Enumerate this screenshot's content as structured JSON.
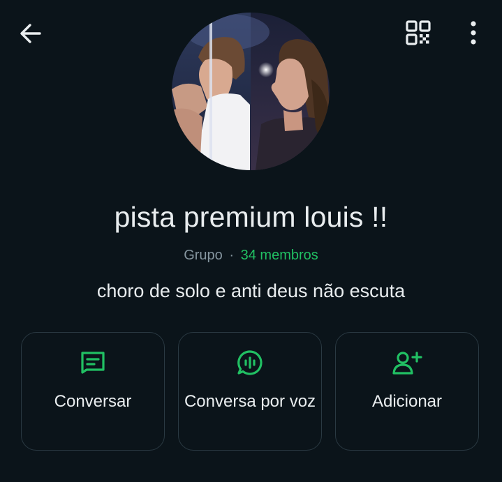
{
  "header": {
    "back_icon": "arrow-left-icon",
    "qr_icon": "qr-code-icon",
    "menu_icon": "more-vertical-icon"
  },
  "group": {
    "name": "pista premium louis !!",
    "type_label": "Grupo",
    "separator": "·",
    "members_label": "34 membros",
    "description": "choro de solo e anti deus não escuta"
  },
  "actions": [
    {
      "label": "Conversar",
      "icon": "message-icon"
    },
    {
      "label": "Conversa por voz",
      "icon": "voice-chat-icon"
    },
    {
      "label": "Adicionar",
      "icon": "add-person-icon"
    }
  ],
  "colors": {
    "background": "#0b141a",
    "accent": "#21c063",
    "text_primary": "#e9edef",
    "text_secondary": "#8696a0",
    "card_border": "#2a3942"
  }
}
